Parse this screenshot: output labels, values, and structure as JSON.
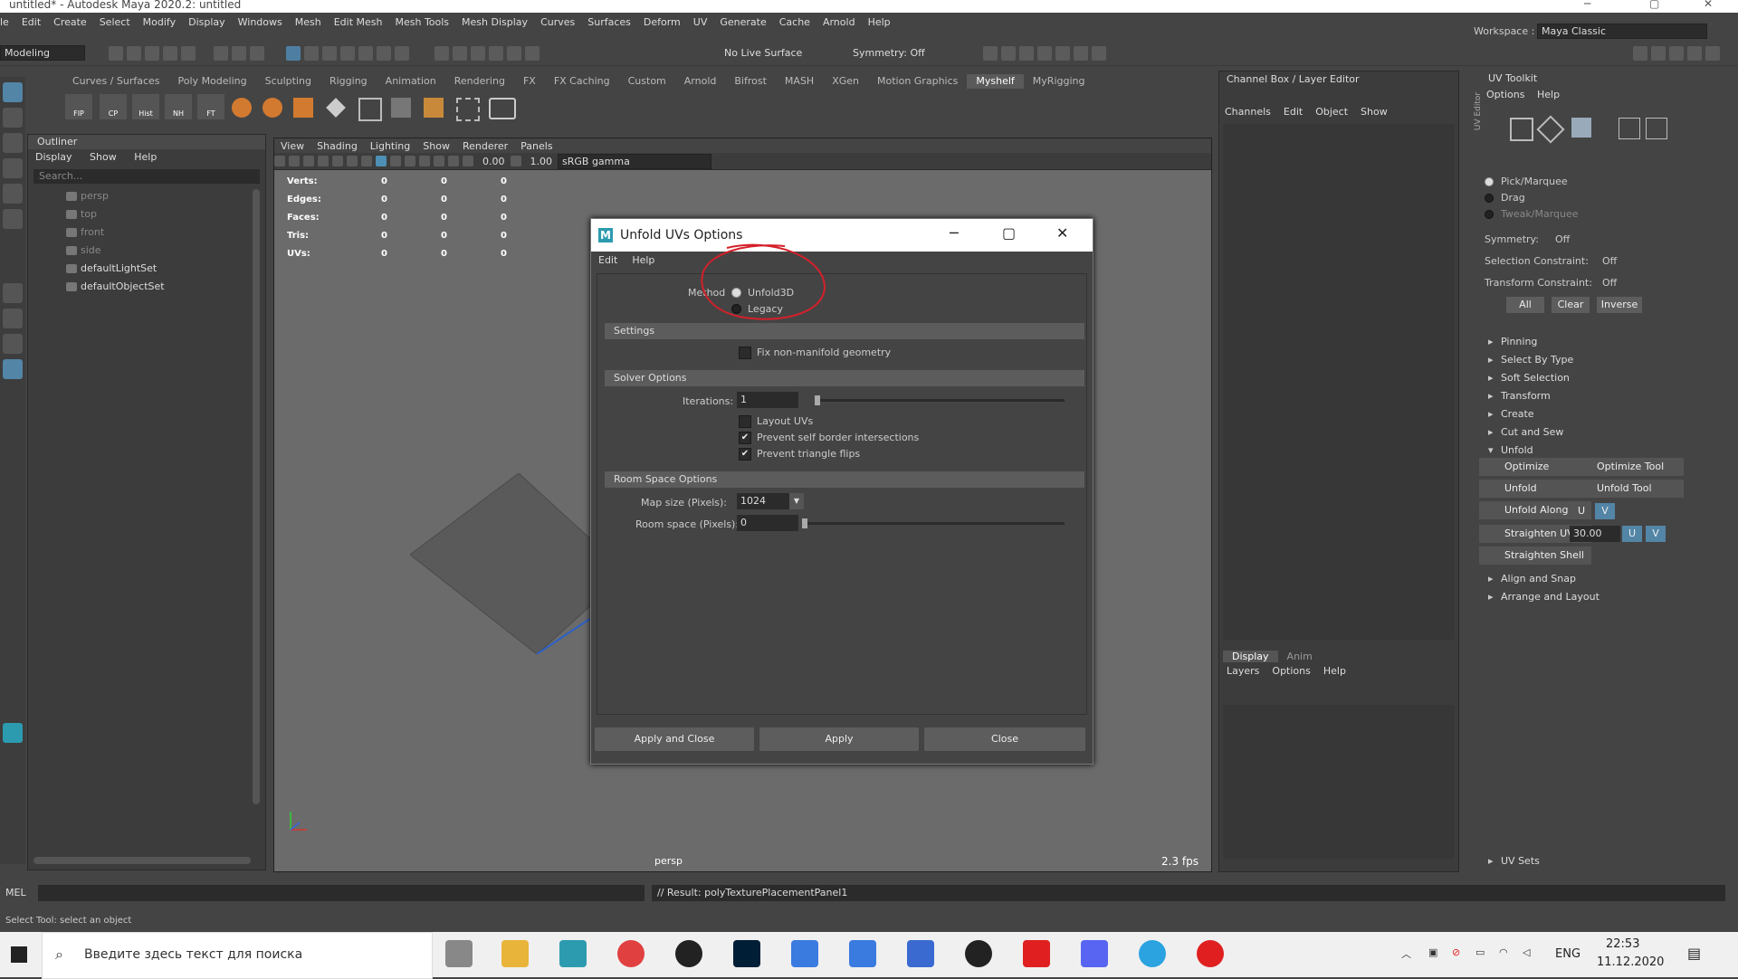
{
  "window": {
    "title": "untitled* - Autodesk Maya 2020.2: untitled"
  },
  "menubar": [
    "le",
    "Edit",
    "Create",
    "Select",
    "Modify",
    "Display",
    "Windows",
    "Mesh",
    "Edit Mesh",
    "Mesh Tools",
    "Mesh Display",
    "Curves",
    "Surfaces",
    "Deform",
    "UV",
    "Generate",
    "Cache",
    "Arnold",
    "Help"
  ],
  "statusline": {
    "mode": "Modeling",
    "live_surface": "No Live Surface",
    "symmetry": "Symmetry: Off",
    "workspace_label": "Workspace :",
    "workspace_value": "Maya Classic"
  },
  "shelf": {
    "tabs": [
      "Curves / Surfaces",
      "Poly Modeling",
      "Sculpting",
      "Rigging",
      "Animation",
      "Rendering",
      "FX",
      "FX Caching",
      "Custom",
      "Arnold",
      "Bifrost",
      "MASH",
      "XGen",
      "Motion Graphics",
      "Myshelf",
      "MyRigging"
    ],
    "active_tab": "Myshelf",
    "icon_labels": [
      "FIP",
      "CP",
      "Hist",
      "NH",
      "FT"
    ]
  },
  "outliner": {
    "title": "Outliner",
    "menu": [
      "Display",
      "Show",
      "Help"
    ],
    "search_placeholder": "Search...",
    "items": [
      {
        "label": "persp",
        "dim": true,
        "icon": "camera-icon"
      },
      {
        "label": "top",
        "dim": true,
        "icon": "camera-icon"
      },
      {
        "label": "front",
        "dim": true,
        "icon": "camera-icon"
      },
      {
        "label": "side",
        "dim": true,
        "icon": "camera-icon"
      },
      {
        "label": "defaultLightSet",
        "dim": false,
        "icon": "set-icon"
      },
      {
        "label": "defaultObjectSet",
        "dim": false,
        "icon": "set-icon"
      }
    ]
  },
  "viewport": {
    "menu": [
      "View",
      "Shading",
      "Lighting",
      "Show",
      "Renderer",
      "Panels"
    ],
    "val1": "0.00",
    "val2": "1.00",
    "colorspace": "sRGB gamma",
    "camera": "persp",
    "fps": "2.3 fps",
    "stats": [
      {
        "label": "Verts:",
        "v": [
          "0",
          "0",
          "0"
        ]
      },
      {
        "label": "Edges:",
        "v": [
          "0",
          "0",
          "0"
        ]
      },
      {
        "label": "Faces:",
        "v": [
          "0",
          "0",
          "0"
        ]
      },
      {
        "label": "Tris:",
        "v": [
          "0",
          "0",
          "0"
        ]
      },
      {
        "label": "UVs:",
        "v": [
          "0",
          "0",
          "0"
        ]
      }
    ]
  },
  "dialog": {
    "title": "Unfold UVs Options",
    "menu": [
      "Edit",
      "Help"
    ],
    "method_label": "Method",
    "method_options": [
      "Unfold3D",
      "Legacy"
    ],
    "method_selected": "Unfold3D",
    "settings_title": "Settings",
    "fix_nonmanifold": "Fix non-manifold geometry",
    "solver_title": "Solver Options",
    "iterations_label": "Iterations:",
    "iterations_value": "1",
    "iterations_slider": 0.0,
    "layout_uvs": "Layout UVs",
    "prevent_border": "Prevent self border intersections",
    "prevent_flips": "Prevent triangle flips",
    "room_title": "Room Space Options",
    "map_size_label": "Map size (Pixels):",
    "map_size_value": "1024",
    "room_space_label": "Room space (Pixels):",
    "room_space_value": "0",
    "buttons": [
      "Apply and Close",
      "Apply",
      "Close"
    ]
  },
  "channelbox": {
    "title": "Channel Box / Layer Editor",
    "menu": [
      "Channels",
      "Edit",
      "Object",
      "Show"
    ],
    "layer_tabs": [
      "Display",
      "Anim"
    ],
    "layer_menu": [
      "Layers",
      "Options",
      "Help"
    ]
  },
  "uvtoolkit": {
    "title": "UV Toolkit",
    "menu": [
      "Options",
      "Help"
    ],
    "side_label": "UV Editor",
    "modes": [
      "Pick/Marquee",
      "Drag",
      "Tweak/Marquee"
    ],
    "symmetry_label": "Symmetry:",
    "symmetry_value": "Off",
    "sel_constraint_label": "Selection Constraint:",
    "sel_constraint_value": "Off",
    "xform_constraint_label": "Transform Constraint:",
    "xform_constraint_value": "Off",
    "sel_buttons": [
      "All",
      "Clear",
      "Inverse"
    ],
    "sections_top": [
      "Pinning",
      "Select By Type",
      "Soft Selection"
    ],
    "sections_mid": [
      "Transform",
      "Create",
      "Cut and Sew"
    ],
    "unfold_title": "Unfold",
    "unfold_buttons": [
      "Optimize",
      "Optimize Tool",
      "Unfold",
      "Unfold Tool",
      "Unfold Along",
      "Straighten UVs",
      "Straighten Shell"
    ],
    "u": "U",
    "v": "V",
    "straighten_value": "30.00",
    "sections_bottom": [
      "Align and Snap",
      "Arrange and Layout"
    ],
    "uv_sets": "UV Sets"
  },
  "cmdline": {
    "lang": "MEL",
    "result": "// Result: polyTexturePlacementPanel1"
  },
  "helpline": "Select Tool: select an object",
  "taskbar": {
    "search_placeholder": "Введите здесь текст для поиска",
    "lang": "ENG",
    "time": "22:53",
    "date": "11.12.2020"
  },
  "colors": {
    "annotation": "#d4202a",
    "accent": "#5285a6",
    "taskbar": "#f0f0f0"
  }
}
